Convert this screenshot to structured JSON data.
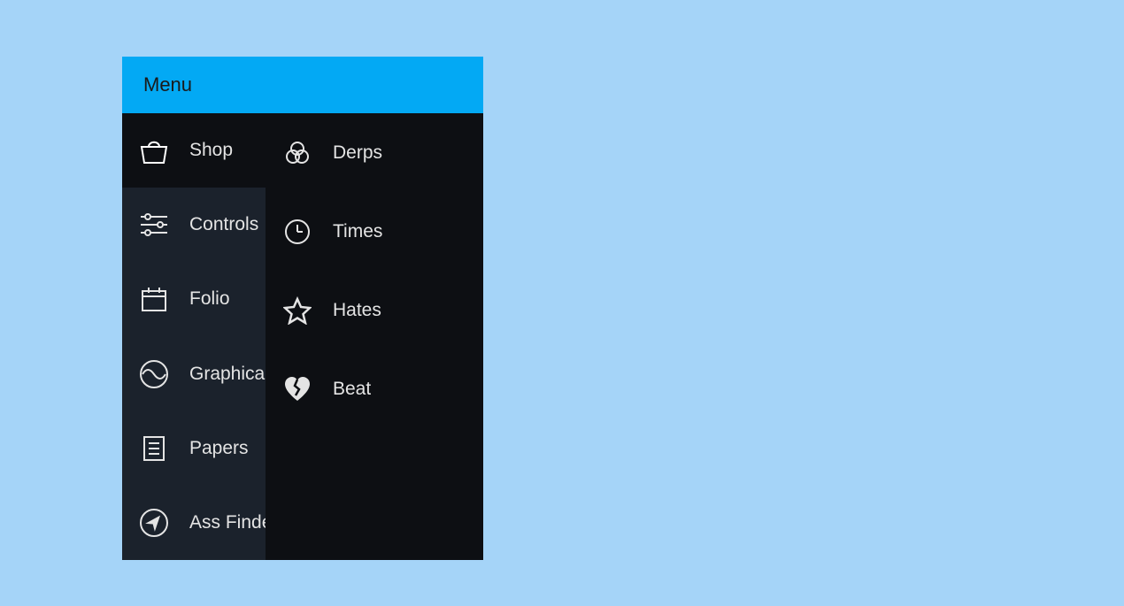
{
  "header": {
    "title": "Menu"
  },
  "left_items": [
    {
      "id": "shop",
      "label": "Shop",
      "icon": "bag-icon",
      "hi": false
    },
    {
      "id": "controls",
      "label": "Controls",
      "icon": "sliders-icon",
      "hi": true
    },
    {
      "id": "folio",
      "label": "Folio",
      "icon": "calendar-icon",
      "hi": true
    },
    {
      "id": "graphical",
      "label": "Graphical",
      "icon": "wave-icon",
      "hi": true
    },
    {
      "id": "papers",
      "label": "Papers",
      "icon": "document-icon",
      "hi": true
    },
    {
      "id": "assfind",
      "label": "Ass Finder",
      "icon": "compass-icon",
      "hi": true
    }
  ],
  "right_items": [
    {
      "id": "derps",
      "label": "Derps",
      "icon": "venn-icon"
    },
    {
      "id": "times",
      "label": "Times",
      "icon": "clock-icon"
    },
    {
      "id": "hates",
      "label": "Hates",
      "icon": "star-icon"
    },
    {
      "id": "beat",
      "label": "Beat",
      "icon": "heartbreak-icon"
    }
  ],
  "colors": {
    "page_bg": "#a5d4f8",
    "header_bg": "#03a9f4",
    "panel_bg": "#0d0f13",
    "panel_highlight": "#1b222c",
    "text": "#e4e4e4"
  }
}
